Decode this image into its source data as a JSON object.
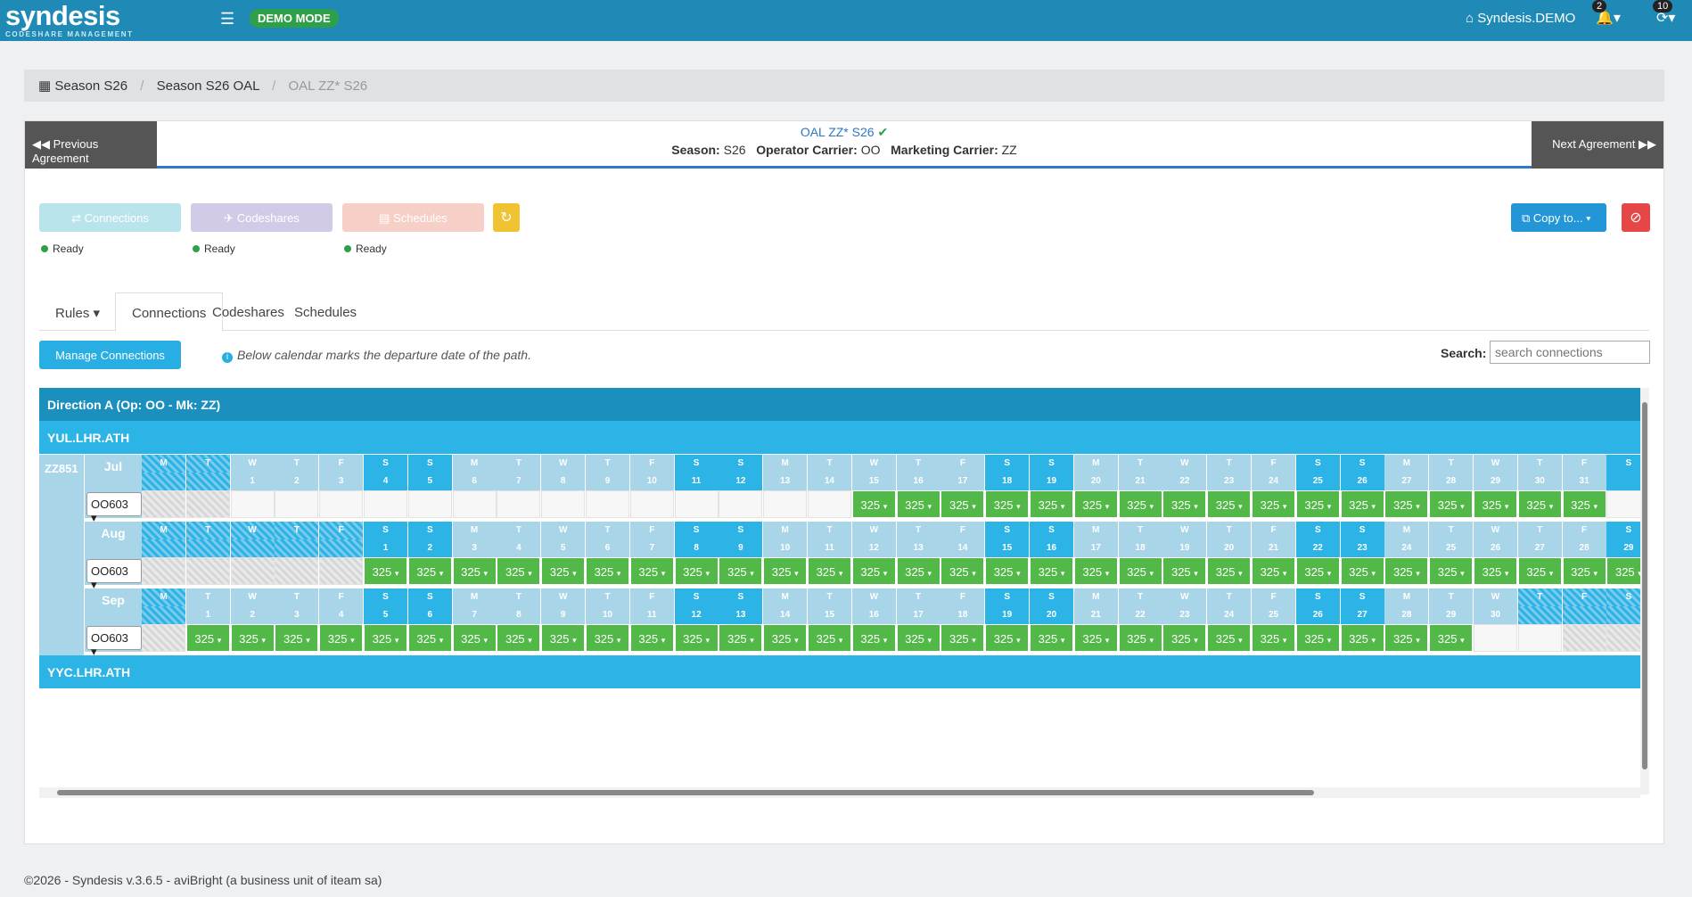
{
  "topbar": {
    "logo": "syndesis",
    "logo_sub": "CODESHARE MANAGEMENT",
    "demo_badge": "DEMO MODE",
    "tenant": "Syndesis.DEMO",
    "notif_count": "2",
    "user_count": "10"
  },
  "breadcrumb": {
    "items": [
      "Season S26",
      "Season S26 OAL",
      "OAL ZZ* S26"
    ]
  },
  "agreement": {
    "prev_label": "Previous Agreement",
    "next_label": "Next Agreement",
    "title": "OAL ZZ* S26",
    "season_label": "Season:",
    "season": "S26",
    "operator_label": "Operator Carrier:",
    "operator": "OO",
    "marketing_label": "Marketing Carrier:",
    "marketing": "ZZ"
  },
  "steps": [
    {
      "label": "Connections",
      "status": "Ready",
      "color": "#b9e4ec"
    },
    {
      "label": "Codeshares",
      "status": "Ready",
      "color": "#d2cbe8"
    },
    {
      "label": "Schedules",
      "status": "Ready",
      "color": "#f6cfc7"
    }
  ],
  "copy_label": "Copy to...",
  "tabs": [
    "Rules",
    "Connections",
    "Codeshares",
    "Schedules"
  ],
  "manage_label": "Manage Connections",
  "info_note": "Below calendar marks the departure date of the path.",
  "search": {
    "label": "Search:",
    "placeholder": "search connections"
  },
  "direction": "Direction A (Op: OO - Mk: ZZ)",
  "routes": [
    "YUL.LHR.ATH",
    "YYC.LHR.ATH"
  ],
  "flight": "ZZ851",
  "option_flight": "OO603",
  "slot_value": "325",
  "months": [
    {
      "name": "Jul",
      "days": [
        "M",
        "T",
        "W",
        "T",
        "F",
        "S",
        "S",
        "M",
        "T",
        "W",
        "T",
        "F",
        "S",
        "S",
        "M",
        "T",
        "W",
        "T",
        "F",
        "S",
        "S",
        "M",
        "T",
        "W",
        "T",
        "F",
        "S",
        "S",
        "M",
        "T",
        "W",
        "T",
        "F",
        "S"
      ],
      "nums": [
        "",
        "",
        "1",
        "2",
        "3",
        "4",
        "5",
        "6",
        "7",
        "8",
        "9",
        "10",
        "11",
        "12",
        "13",
        "14",
        "15",
        "16",
        "17",
        "18",
        "19",
        "20",
        "21",
        "22",
        "23",
        "24",
        "25",
        "26",
        "27",
        "28",
        "29",
        "30",
        "31",
        ""
      ],
      "hatch": [
        0,
        1
      ],
      "na": [
        0,
        1
      ],
      "on_from": 16,
      "on_to": 32
    },
    {
      "name": "Aug",
      "days": [
        "M",
        "T",
        "W",
        "T",
        "F",
        "S",
        "S",
        "M",
        "T",
        "W",
        "T",
        "F",
        "S",
        "S",
        "M",
        "T",
        "W",
        "T",
        "F",
        "S",
        "S",
        "M",
        "T",
        "W",
        "T",
        "F",
        "S",
        "S",
        "M",
        "T",
        "W",
        "T",
        "F",
        "S"
      ],
      "nums": [
        "",
        "",
        "",
        "",
        "",
        "1",
        "2",
        "3",
        "4",
        "5",
        "6",
        "7",
        "8",
        "9",
        "10",
        "11",
        "12",
        "13",
        "14",
        "15",
        "16",
        "17",
        "18",
        "19",
        "20",
        "21",
        "22",
        "23",
        "24",
        "25",
        "26",
        "27",
        "28",
        "29"
      ],
      "hatch": [
        0,
        1,
        2,
        3,
        4
      ],
      "na": [
        0,
        1,
        2,
        3,
        4
      ],
      "on_from": 5,
      "on_to": 33
    },
    {
      "name": "Sep",
      "days": [
        "M",
        "T",
        "W",
        "T",
        "F",
        "S",
        "S",
        "M",
        "T",
        "W",
        "T",
        "F",
        "S",
        "S",
        "M",
        "T",
        "W",
        "T",
        "F",
        "S",
        "S",
        "M",
        "T",
        "W",
        "T",
        "F",
        "S",
        "S",
        "M",
        "T",
        "W",
        "T",
        "F",
        "S"
      ],
      "nums": [
        "",
        "1",
        "2",
        "3",
        "4",
        "5",
        "6",
        "7",
        "8",
        "9",
        "10",
        "11",
        "12",
        "13",
        "14",
        "15",
        "16",
        "17",
        "18",
        "19",
        "20",
        "21",
        "22",
        "23",
        "24",
        "25",
        "26",
        "27",
        "28",
        "29",
        "30",
        "",
        "",
        ""
      ],
      "hatch": [
        0,
        31,
        32,
        33
      ],
      "na": [
        0,
        32,
        33
      ],
      "on_from": 1,
      "on_to": 29
    }
  ],
  "footer": "©2026 - Syndesis v.3.6.5 - aviBright (a business unit of iteam sa)"
}
